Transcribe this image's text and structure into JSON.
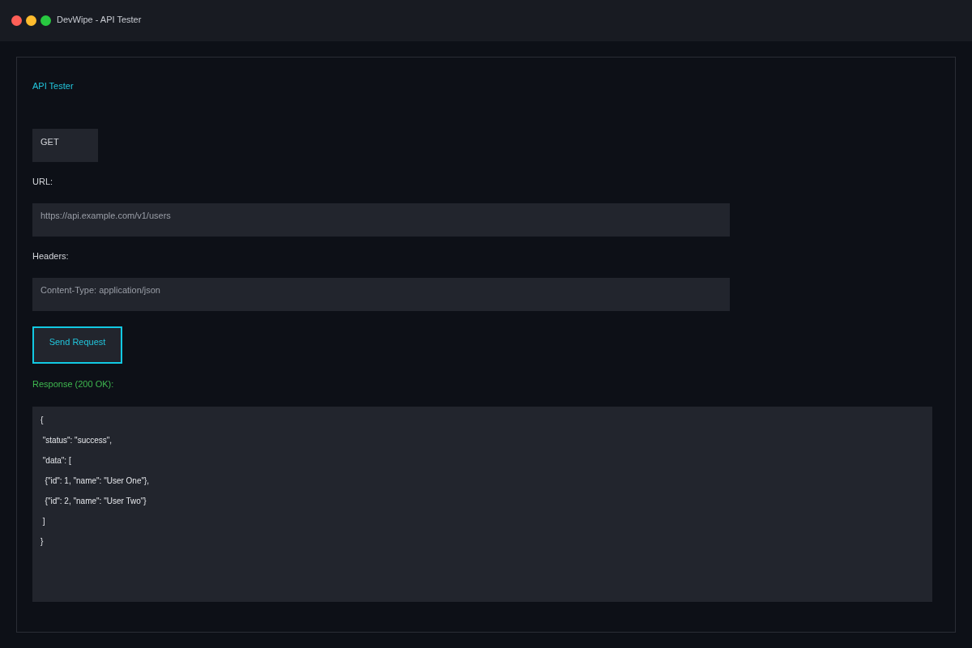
{
  "window": {
    "title": "DevWipe - API Tester"
  },
  "panel": {
    "title": "API Tester",
    "method": "GET",
    "url_label": "URL:",
    "url_field": {
      "value": "https://api.example.com/v1/users"
    },
    "headers_label": "Headers:",
    "headers_field": {
      "value": "Content-Type: application/json"
    },
    "send_button": "Send Request",
    "response_label": "Response (200 OK):",
    "response_lines": [
      "{",
      " \"status\": \"success\",",
      " \"data\": [",
      "  {\"id\": 1, \"name\": \"User One\"},",
      "  {\"id\": 2, \"name\": \"User Two\"}",
      " ]",
      "}"
    ]
  }
}
